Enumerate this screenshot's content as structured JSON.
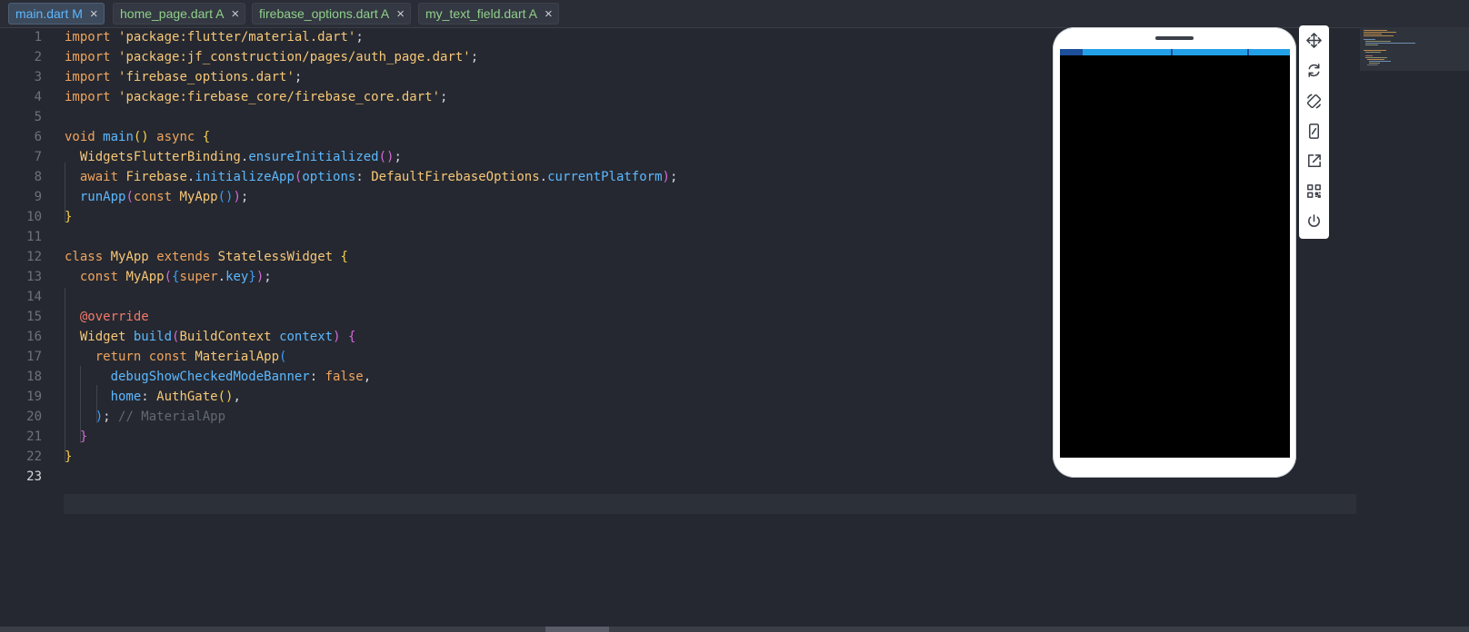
{
  "tabs": [
    {
      "label": "main.dart M",
      "close": "×",
      "active": true
    },
    {
      "label": "home_page.dart A",
      "close": "×",
      "active": false
    },
    {
      "label": "firebase_options.dart A",
      "close": "×",
      "active": false
    },
    {
      "label": "my_text_field.dart A",
      "close": "×",
      "active": false
    }
  ],
  "editor": {
    "current_line": 23,
    "lines": [
      {
        "n": "1",
        "text": "import 'package:flutter/material.dart';"
      },
      {
        "n": "2",
        "text": "import 'package:jf_construction/pages/auth_page.dart';"
      },
      {
        "n": "3",
        "text": "import 'firebase_options.dart';"
      },
      {
        "n": "4",
        "text": "import 'package:firebase_core/firebase_core.dart';"
      },
      {
        "n": "5",
        "text": ""
      },
      {
        "n": "6",
        "text": "void main() async {"
      },
      {
        "n": "7",
        "text": "  WidgetsFlutterBinding.ensureInitialized();"
      },
      {
        "n": "8",
        "text": "  await Firebase.initializeApp(options: DefaultFirebaseOptions.currentPlatform);"
      },
      {
        "n": "9",
        "text": "  runApp(const MyApp());"
      },
      {
        "n": "10",
        "text": "}"
      },
      {
        "n": "11",
        "text": ""
      },
      {
        "n": "12",
        "text": "class MyApp extends StatelessWidget {"
      },
      {
        "n": "13",
        "text": "  const MyApp({super.key});"
      },
      {
        "n": "14",
        "text": ""
      },
      {
        "n": "15",
        "text": "  @override"
      },
      {
        "n": "16",
        "text": "  Widget build(BuildContext context) {"
      },
      {
        "n": "17",
        "text": "    return const MaterialApp("
      },
      {
        "n": "18",
        "text": "      debugShowCheckedModeBanner: false,"
      },
      {
        "n": "19",
        "text": "      home: AuthGate(),"
      },
      {
        "n": "20",
        "text": "    ); // MaterialApp"
      },
      {
        "n": "21",
        "text": "  }"
      },
      {
        "n": "22",
        "text": "}"
      },
      {
        "n": "23",
        "text": ""
      }
    ]
  },
  "device_preview": {
    "status_bar_color": "#23a1e8",
    "screen_color": "#000000",
    "tools": [
      {
        "icon": "move-icon"
      },
      {
        "icon": "refresh-icon"
      },
      {
        "icon": "rotate-device-icon"
      },
      {
        "icon": "device-frame-icon"
      },
      {
        "icon": "open-external-icon"
      },
      {
        "icon": "qr-code-icon"
      },
      {
        "icon": "power-icon"
      }
    ]
  }
}
